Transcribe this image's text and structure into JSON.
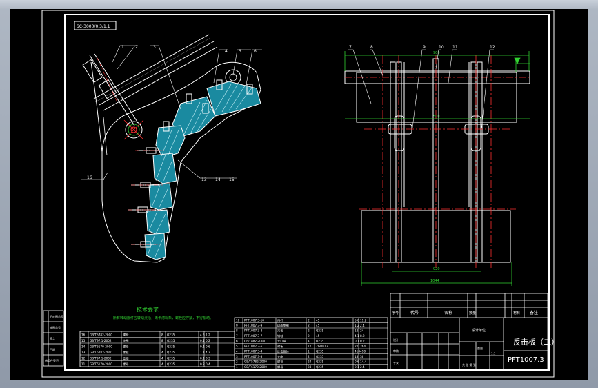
{
  "drawing": {
    "header_label": "SC-3000/0.3/1.1",
    "title": "反击板（二）",
    "drawing_number": "PFT1007.3",
    "notes_title": "技术要求",
    "notes_text": "所有转动部件应转动灵活，无卡滞现象，螺栓应拧紧，不得松动。",
    "scale": "1:1"
  },
  "left_view": {
    "callouts_top": [
      "1",
      "2",
      "3",
      "4",
      "5",
      "6"
    ],
    "callouts_bottom": [
      "16",
      "15",
      "14",
      "13"
    ]
  },
  "right_view": {
    "callouts_top": [
      "7",
      "8",
      "9",
      "10",
      "11",
      "12"
    ],
    "dim_top": "900",
    "dim_mid": "500",
    "dim_bottom_inner": "920",
    "dim_bottom_outer": "1044"
  },
  "title_block": {
    "headers": [
      "序号",
      "代号",
      "名称",
      "数量",
      "材料",
      "备注"
    ],
    "company_label": "设计单位",
    "sign_labels": [
      "设计",
      "审核",
      "工艺"
    ],
    "weight_label": "重量",
    "sheet_label": "共 张 第 张"
  },
  "bom_left": {
    "rows": [
      [
        "16",
        "GB/T5782-2000",
        "螺栓",
        "8",
        "Q235",
        "4.6",
        "1.2"
      ],
      [
        "15",
        "GB/T97.1-2002",
        "垫圈",
        "8",
        "Q235",
        "0.1",
        "0.2"
      ],
      [
        "14",
        "GB/T6170-2000",
        "螺母",
        "8",
        "Q235",
        "0.1",
        "0.6"
      ],
      [
        "13",
        "GB/T5782-2000",
        "螺栓",
        "4",
        "Q235",
        "1.1",
        "4.2"
      ],
      [
        "12",
        "GB/T97.1-2002",
        "垫圈",
        "4",
        "Q235",
        "0.1",
        "0.3"
      ],
      [
        "11",
        "GB/T6170-2000",
        "螺母",
        "4",
        "Q235",
        "0.2",
        "0.4"
      ]
    ]
  },
  "bom_right": {
    "rows": [
      [
        "10",
        "PFT1007.3-10",
        "吊杆",
        "2",
        "45",
        "5.6",
        "11.2"
      ],
      [
        "9",
        "PFT1007.3-9",
        "球面垫圈",
        "2",
        "45",
        "1.2",
        "2.4"
      ],
      [
        "8",
        "PFT1007.3-8",
        "吊板",
        "2",
        "Q235",
        "12",
        "24"
      ],
      [
        "7",
        "PFT1007.3-7",
        "销轴",
        "2",
        "45",
        "4.1",
        "8.2"
      ],
      [
        "6",
        "GB/T882-2000",
        "开口销",
        "4",
        "Q235",
        "0.1",
        "0.2"
      ],
      [
        "5",
        "PFT1007.3-5",
        "衬板",
        "12",
        "ZGMn13",
        "22",
        "264"
      ],
      [
        "4",
        "PFT1007.3-4",
        "反击板体",
        "1",
        "Q235",
        "410",
        "410"
      ],
      [
        "3",
        "PFT1007.3-3",
        "支座",
        "2",
        "Q235",
        "18",
        "36"
      ],
      [
        "2",
        "GB/T5782-2000",
        "螺栓",
        "24",
        "Q235",
        "0.6",
        "14.4"
      ],
      [
        "1",
        "GB/T6170-2000",
        "螺母",
        "24",
        "Q235",
        "0.1",
        "2.4"
      ]
    ]
  },
  "left_strip": {
    "labels": [
      "旧底图总号",
      "底图总号",
      "签字",
      "日期",
      "借用件登记"
    ]
  }
}
